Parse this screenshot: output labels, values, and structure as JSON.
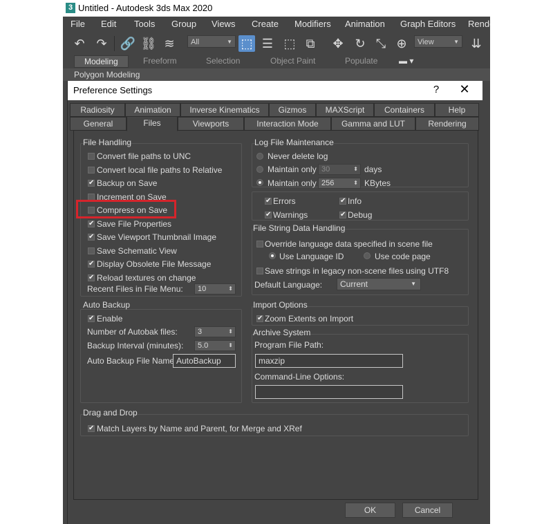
{
  "window": {
    "title": "Untitled - Autodesk 3ds Max 2020",
    "app_icon": "3"
  },
  "menu": [
    "File",
    "Edit",
    "Tools",
    "Group",
    "Views",
    "Create",
    "Modifiers",
    "Animation",
    "Graph Editors",
    "Rende"
  ],
  "toolbar": {
    "selection_filter": "All",
    "view_dropdown": "View"
  },
  "ribbon": {
    "tabs": [
      "Modeling",
      "Freeform",
      "Selection",
      "Object Paint",
      "Populate"
    ],
    "active": "Modeling",
    "sub": "Polygon Modeling"
  },
  "dialog": {
    "title": "Preference Settings",
    "help": "?",
    "close": "✕",
    "tabs_row1": [
      "Radiosity",
      "Animation",
      "Inverse Kinematics",
      "Gizmos",
      "MAXScript",
      "Containers",
      "Help"
    ],
    "tabs_row2": [
      "General",
      "Files",
      "Viewports",
      "Interaction Mode",
      "Gamma and LUT",
      "Rendering"
    ],
    "active_tab": "Files",
    "file_handling": {
      "title": "File Handling",
      "options": [
        {
          "label": "Convert file paths to UNC",
          "checked": false
        },
        {
          "label": "Convert local file paths to Relative",
          "checked": false
        },
        {
          "label": "Backup on Save",
          "checked": true
        },
        {
          "label": "Increment on Save",
          "checked": false
        },
        {
          "label": "Compress on Save",
          "checked": false
        },
        {
          "label": "Save File Properties",
          "checked": true
        },
        {
          "label": "Save Viewport Thumbnail Image",
          "checked": true
        },
        {
          "label": "Save Schematic View",
          "checked": false
        },
        {
          "label": "Display Obsolete File Message",
          "checked": true
        },
        {
          "label": "Reload textures on change",
          "checked": true
        }
      ],
      "recent_label": "Recent Files in File Menu:",
      "recent_value": "10"
    },
    "log": {
      "title": "Log File Maintenance",
      "never": "Never delete log",
      "maintain1": "Maintain only",
      "maintain1_value": "30",
      "maintain1_unit": "days",
      "maintain2": "Maintain only",
      "maintain2_value": "256",
      "maintain2_unit": "KBytes",
      "errors": "Errors",
      "info": "Info",
      "warnings": "Warnings",
      "debug": "Debug"
    },
    "string_handling": {
      "title": "File String Data Handling",
      "override": "Override language data specified in scene file",
      "use_lang": "Use Language ID",
      "use_code": "Use code page",
      "legacy": "Save strings in legacy non-scene files using UTF8",
      "default_label": "Default Language:",
      "default_value": "Current"
    },
    "auto_backup": {
      "title": "Auto Backup",
      "enable": "Enable",
      "num_label": "Number of Autobak files:",
      "num_value": "3",
      "interval_label": "Backup Interval (minutes):",
      "interval_value": "5.0",
      "name_label": "Auto Backup File Name:",
      "name_value": "AutoBackup"
    },
    "import": {
      "title": "Import Options",
      "zoom": "Zoom Extents on Import"
    },
    "archive": {
      "title": "Archive System",
      "path_label": "Program File Path:",
      "path_value": "maxzip",
      "cmd_label": "Command-Line Options:",
      "cmd_value": ""
    },
    "drag_drop": {
      "title": "Drag and Drop",
      "match": "Match Layers by Name and Parent, for Merge and XRef"
    },
    "ok": "OK",
    "cancel": "Cancel"
  },
  "colors": {
    "highlight": "#d6242b",
    "accent": "#5b8fcc"
  }
}
